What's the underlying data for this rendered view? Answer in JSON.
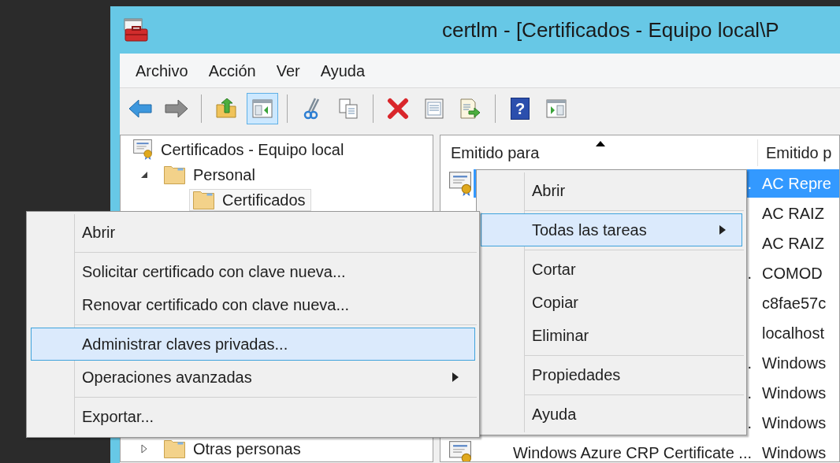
{
  "window": {
    "title": "certlm - [Certificados - Equipo local\\P"
  },
  "menu_bar": [
    "Archivo",
    "Acción",
    "Ver",
    "Ayuda"
  ],
  "toolbar": [
    {
      "pressed": false
    },
    {
      "pressed": false
    },
    {
      "pressed": false
    },
    {
      "pressed": true
    },
    {
      "pressed": false
    },
    {
      "pressed": false
    },
    {
      "pressed": false
    },
    {
      "pressed": false
    },
    {
      "pressed": false
    },
    {
      "pressed": false,
      "glyph": "?"
    },
    {
      "pressed": false
    }
  ],
  "tree": {
    "label": "Certificados - Equipo local",
    "children": [
      {
        "label": "Personal",
        "expanded": true,
        "selected": false,
        "children": [
          {
            "label": "Certificados",
            "selected": true
          }
        ]
      },
      {
        "label": "Otras personas",
        "expanded": false,
        "selected": false
      }
    ]
  },
  "list": {
    "columns": [
      {
        "label": "Emitido para",
        "sorted": true
      },
      {
        "label": "Emitido p"
      }
    ],
    "rows": [
      {
        "issued_to": ".",
        "issued_by": "AC Repre",
        "selected": true
      },
      {
        "issued_by": "AC RAIZ",
        "selected": false
      },
      {
        "issued_by": "AC RAIZ",
        "selected": false
      },
      {
        "issued_to": ".",
        "issued_by": "COMOD",
        "selected": false
      },
      {
        "issued_by": "c8fae57c",
        "selected": false
      },
      {
        "issued_by": "localhost",
        "selected": false
      },
      {
        "issued_to": ".",
        "issued_by": "Windows",
        "selected": false
      },
      {
        "issued_to": ".",
        "issued_by": "Windows",
        "selected": false
      },
      {
        "issued_to": ".",
        "issued_by": "Windows",
        "selected": false
      },
      {
        "issued_to": "Windows Azure CRP Certificate ...",
        "issued_by": "Windows",
        "selected": false
      }
    ]
  },
  "context_menu": {
    "items": [
      {
        "kind": "item",
        "label": "Abrir",
        "selected": false,
        "has_submenu": false
      },
      {
        "kind": "separator"
      },
      {
        "kind": "item",
        "label": "Todas las tareas",
        "selected": true,
        "has_submenu": true
      },
      {
        "kind": "separator"
      },
      {
        "kind": "item",
        "label": "Cortar",
        "selected": false,
        "has_submenu": false
      },
      {
        "kind": "item",
        "label": "Copiar",
        "selected": false,
        "has_submenu": false
      },
      {
        "kind": "item",
        "label": "Eliminar",
        "selected": false,
        "has_submenu": false
      },
      {
        "kind": "separator"
      },
      {
        "kind": "item",
        "label": "Propiedades",
        "selected": false,
        "has_submenu": false
      },
      {
        "kind": "separator"
      },
      {
        "kind": "item",
        "label": "Ayuda",
        "selected": false,
        "has_submenu": false
      }
    ]
  },
  "submenu": {
    "items": [
      {
        "kind": "item",
        "label": "Abrir",
        "selected": false,
        "has_submenu": false
      },
      {
        "kind": "separator"
      },
      {
        "kind": "item",
        "label": "Solicitar certificado con clave nueva...",
        "selected": false,
        "has_submenu": false
      },
      {
        "kind": "item",
        "label": "Renovar certificado con clave nueva...",
        "selected": false,
        "has_submenu": false
      },
      {
        "kind": "separator"
      },
      {
        "kind": "item",
        "label": "Administrar claves privadas...",
        "selected": true,
        "has_submenu": false
      },
      {
        "kind": "item",
        "label": "Operaciones avanzadas",
        "selected": false,
        "has_submenu": true
      },
      {
        "kind": "separator"
      },
      {
        "kind": "item",
        "label": "Exportar...",
        "selected": false,
        "has_submenu": false
      }
    ]
  }
}
